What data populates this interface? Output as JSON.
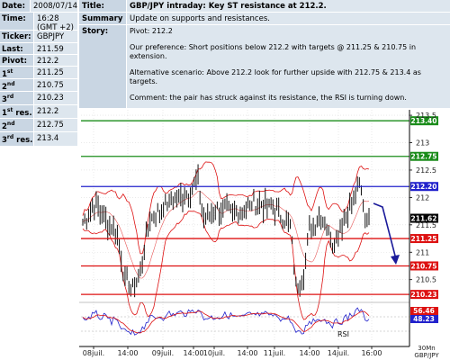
{
  "left": {
    "rows": [
      {
        "key": "Date:",
        "value": "2008/07/14"
      },
      {
        "key": "Time:",
        "value": "16:28 (GMT +2)"
      },
      {
        "key": "Ticker:",
        "value": "GBPJPY"
      },
      {
        "key": "Last:",
        "value": "211.59"
      },
      {
        "key": "Pivot:",
        "value": "212.2"
      },
      {
        "key_num": "1",
        "key_suffix": "st",
        "key_tail": "sup.",
        "value": "211.25"
      },
      {
        "key_num": "2",
        "key_suffix": "nd",
        "key_tail": "sup.",
        "value": "210.75"
      },
      {
        "key_num": "3",
        "key_suffix": "rd",
        "key_tail": "sup.",
        "value": "210.23"
      },
      {
        "key_num": "1",
        "key_suffix": "st",
        "key_tail": "res.",
        "value": "212.2"
      },
      {
        "key_num": "2",
        "key_suffix": "nd",
        "key_tail": "res.",
        "value": "212.75"
      },
      {
        "key_num": "3",
        "key_suffix": "rd",
        "key_tail": "res.",
        "value": "213.4"
      }
    ]
  },
  "right": {
    "title_key": "Title:",
    "title_value": "GBP/JPY intraday: Key ST resistance at 212.2.",
    "summary_key": "Summary",
    "summary_value": "Update on supports and resistances.",
    "story_key": "Story:",
    "story_pivot": "Pivot: 212.2",
    "story_p1": "Our preference: Short positions below 212.2 with targets @ 211.25 & 210.75 in extension.",
    "story_p2": "Alternative scenario: Above 212.2 look for further upside with 212.75 & 213.4 as targets.",
    "story_p3": "Comment: the pair has struck against its resistance, the RSI is turning down."
  },
  "chart_data": {
    "type": "line",
    "instrument": "GBP/JPY",
    "timeframe": "30Mn",
    "yticks": [
      "213.5",
      "213",
      "212.5",
      "212",
      "211.5",
      "211",
      "210.5"
    ],
    "xticks": [
      "08juil.",
      "14:00",
      "09juil.",
      "14:00",
      "10juil.",
      "14:00",
      "11juil.",
      "14:00",
      "14juil.",
      "16:00"
    ],
    "levels": [
      {
        "value": 213.4,
        "label": "213.40",
        "color": "#1a8c1a"
      },
      {
        "value": 212.75,
        "label": "212.75",
        "color": "#1a8c1a"
      },
      {
        "value": 212.2,
        "label": "212.20",
        "color": "#2222cc"
      },
      {
        "value": 211.25,
        "label": "211.25",
        "color": "#dd1111"
      },
      {
        "value": 210.75,
        "label": "210.75",
        "color": "#dd1111"
      },
      {
        "value": 210.23,
        "label": "210.23",
        "color": "#dd1111"
      }
    ],
    "last": {
      "value": 211.62,
      "label": "211.62"
    },
    "ylim": [
      210.15,
      213.6
    ],
    "rsi": {
      "label": "RSI",
      "value1": "56.46",
      "value2": "48.23"
    },
    "colors": {
      "green": "#1a8c1a",
      "blue": "#2222cc",
      "red": "#dd1111",
      "arrow": "#1a1a9a"
    }
  }
}
